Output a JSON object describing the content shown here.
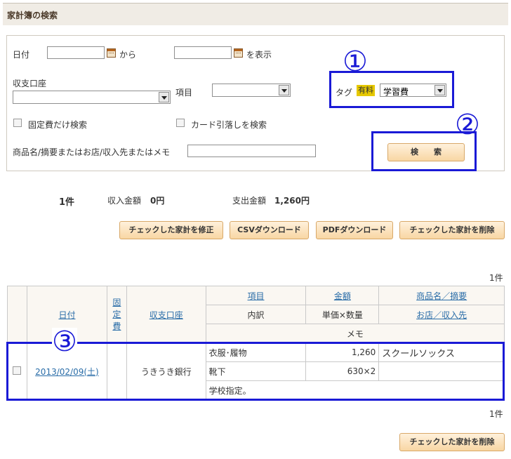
{
  "header": {
    "title": "家計簿の検索"
  },
  "search": {
    "date_label": "日付",
    "from_label": "から",
    "to_label": "を表示",
    "date_from": "",
    "date_to": "",
    "account_label": "収支口座",
    "account_value": "",
    "item_label": "項目",
    "item_value": "",
    "tag_label": "タグ",
    "tag_badge": "有料",
    "tag_value": "学習費",
    "fixed_only_label": "固定費だけ検索",
    "card_label": "カード引落しを検索",
    "keyword_label": "商品名/摘要またはお店/収入先またはメモ",
    "keyword_value": "",
    "search_button": "検　　索"
  },
  "annotations": {
    "n1": "①",
    "n2": "②",
    "n3": "③"
  },
  "summary": {
    "count": "1件",
    "income_label": "収入金額",
    "income_value": "0円",
    "expense_label": "支出金額",
    "expense_value": "1,260円"
  },
  "actions": {
    "modify": "チェックした家計を修正",
    "csv": "CSVダウンロード",
    "pdf": "PDFダウンロード",
    "delete": "チェックした家計を削除"
  },
  "table": {
    "count_top": "1件",
    "count_bottom": "1件",
    "headers": {
      "date": "日付",
      "fixed1": "固",
      "fixed2": "定",
      "fixed3": "費",
      "account": "収支口座",
      "item": "項目",
      "amount": "金額",
      "product": "商品名／摘要",
      "breakdown": "内訳",
      "unit_qty": "単価×数量",
      "shop": "お店／収入先",
      "memo": "メモ"
    },
    "rows": [
      {
        "date": "2013/02/09(土)",
        "account": "うきうき銀行",
        "item": "衣服･履物",
        "amount": "1,260",
        "product": "スクールソックス",
        "breakdown": "靴下",
        "unit_qty": "630×2",
        "shop": "",
        "memo": "学校指定。"
      }
    ]
  },
  "bottom": {
    "delete": "チェックした家計を削除"
  }
}
